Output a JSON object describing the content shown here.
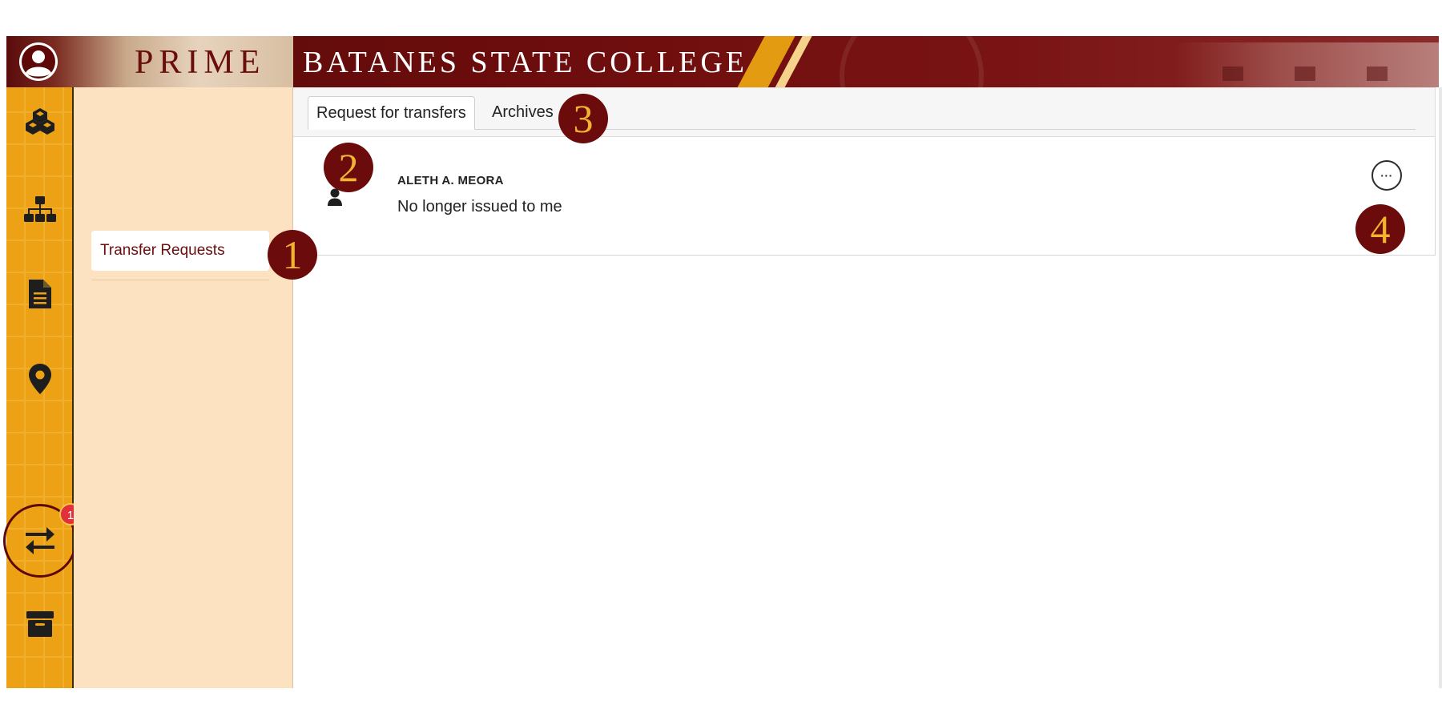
{
  "header": {
    "brand_text": "PRIME",
    "school_title": "BATANES STATE COLLEGE"
  },
  "rail": {
    "items": [
      {
        "icon": "cubes-icon"
      },
      {
        "icon": "sitemap-icon"
      },
      {
        "icon": "document-icon"
      },
      {
        "icon": "map-marker-icon"
      },
      {
        "icon": "transfer-arrows-icon",
        "active": true,
        "badge": "1"
      },
      {
        "icon": "archive-box-icon"
      }
    ],
    "badge_count": "1"
  },
  "subnav": {
    "items": [
      {
        "label": "Transfer Requests",
        "active": true
      }
    ]
  },
  "tabs": [
    {
      "label": "Request for transfers",
      "active": true
    },
    {
      "label": "Archives",
      "active": false
    }
  ],
  "requests": [
    {
      "requester": "ALETH A. MEORA",
      "reason": "No longer issued to me",
      "menu_label": "···"
    }
  ],
  "callouts": [
    "1",
    "2",
    "3",
    "4"
  ],
  "colors": {
    "maroon": "#6b0b0b",
    "gold": "#eda215",
    "peach": "#fde2c1",
    "badge_red": "#e0303a"
  }
}
